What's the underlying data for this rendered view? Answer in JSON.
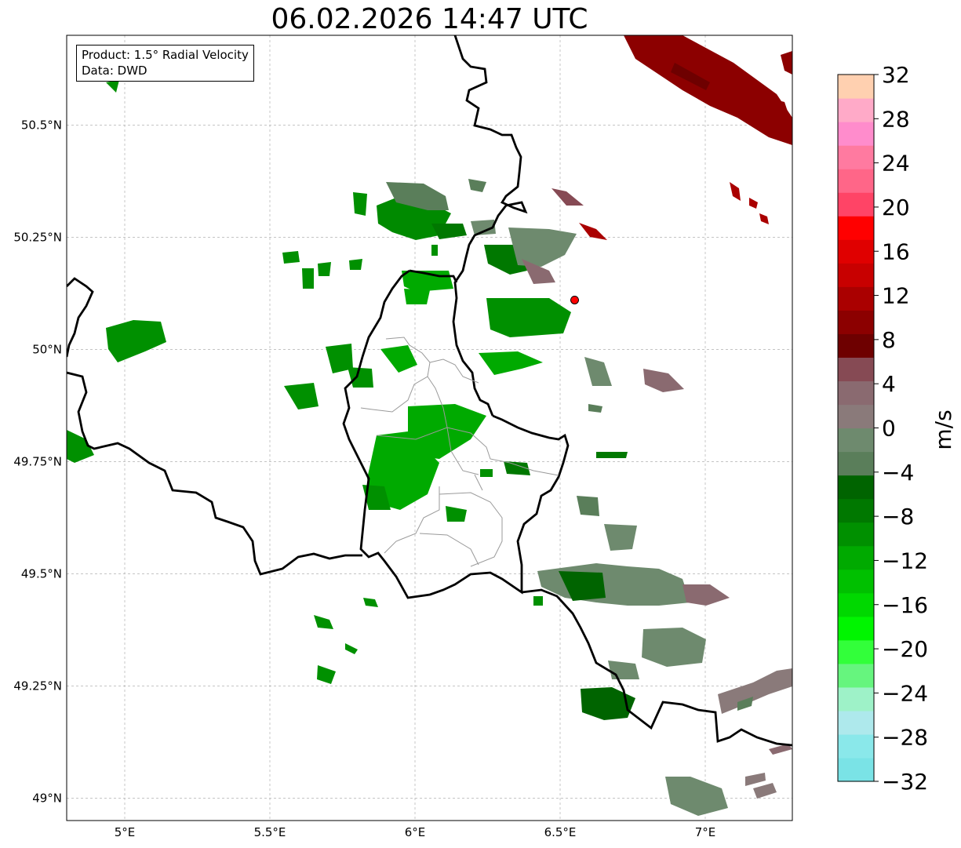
{
  "title": "06.02.2026 14:47 UTC",
  "info": {
    "product": "Product: 1.5° Radial Velocity",
    "source": "Data: DWD"
  },
  "map": {
    "lon_range": [
      4.8,
      7.3
    ],
    "lat_range": [
      48.95,
      50.7
    ],
    "x_ticks": [
      {
        "value": 5.0,
        "label": "5°E"
      },
      {
        "value": 5.5,
        "label": "5.5°E"
      },
      {
        "value": 6.0,
        "label": "6°E"
      },
      {
        "value": 6.5,
        "label": "6.5°E"
      },
      {
        "value": 7.0,
        "label": "7°E"
      }
    ],
    "y_ticks": [
      {
        "value": 50.5,
        "label": "50.5°N"
      },
      {
        "value": 50.25,
        "label": "50.25°N"
      },
      {
        "value": 50.0,
        "label": "50°N"
      },
      {
        "value": 49.75,
        "label": "49.75°N"
      },
      {
        "value": 49.5,
        "label": "49.5°N"
      },
      {
        "value": 49.25,
        "label": "49.25°N"
      },
      {
        "value": 49.0,
        "label": "49°N"
      }
    ],
    "grid": true,
    "radar_site": {
      "lon": 6.55,
      "lat": 50.11,
      "color": "#ff0000"
    }
  },
  "colorbar": {
    "label": "m/s",
    "vmin": -32,
    "vmax": 32,
    "ticks": [
      {
        "value": 32,
        "label": "32"
      },
      {
        "value": 28,
        "label": "28"
      },
      {
        "value": 24,
        "label": "24"
      },
      {
        "value": 20,
        "label": "20"
      },
      {
        "value": 16,
        "label": "16"
      },
      {
        "value": 12,
        "label": "12"
      },
      {
        "value": 8,
        "label": "8"
      },
      {
        "value": 4,
        "label": "4"
      },
      {
        "value": 0,
        "label": "0"
      },
      {
        "value": -4,
        "label": "−4"
      },
      {
        "value": -8,
        "label": "−8"
      },
      {
        "value": -12,
        "label": "−12"
      },
      {
        "value": -16,
        "label": "−16"
      },
      {
        "value": -20,
        "label": "−20"
      },
      {
        "value": -24,
        "label": "−24"
      },
      {
        "value": -28,
        "label": "−28"
      },
      {
        "value": -32,
        "label": "−32"
      }
    ],
    "colors_bottom_to_top": [
      "#7ae3e6",
      "#8ae8ea",
      "#aee9ec",
      "#9ef2c8",
      "#66f57e",
      "#32ff3a",
      "#00f500",
      "#00d800",
      "#00c000",
      "#00aa00",
      "#009000",
      "#007800",
      "#006400",
      "#5a7e5a",
      "#6e8a6e",
      "#8a7a7a",
      "#8a6a70",
      "#864a54",
      "#6e0000",
      "#8c0000",
      "#aa0000",
      "#c80000",
      "#e00000",
      "#ff0000",
      "#ff4466",
      "#ff6688",
      "#ff7aa0",
      "#ff8ccc",
      "#ffaac8",
      "#ffd0b0"
    ]
  }
}
